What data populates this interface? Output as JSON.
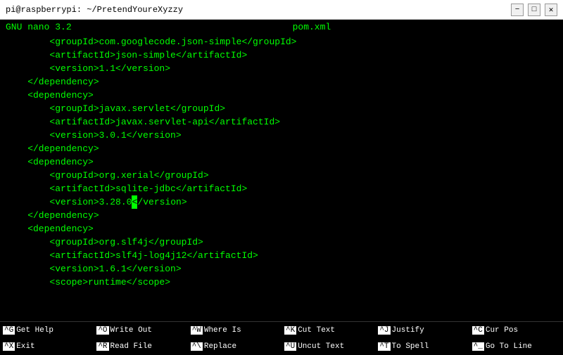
{
  "titlebar": {
    "text": "pi@raspberrypi: ~/PretendYoureXyzzy",
    "minimize": "−",
    "maximize": "□",
    "close": "✕"
  },
  "nano": {
    "header_left": "GNU nano 3.2",
    "filename": "pom.xml"
  },
  "editor": {
    "lines": [
      "        <groupId>com.googlecode.json-simple</groupId>",
      "        <artifactId>json-simple</artifactId>",
      "        <version>1.1</version>",
      "    </dependency>",
      "    <dependency>",
      "        <groupId>javax.servlet</groupId>",
      "        <artifactId>javax.servlet-api</artifactId>",
      "        <version>3.0.1</version>",
      "    </dependency>",
      "    <dependency>",
      "        <groupId>org.xerial</groupId>",
      "        <artifactId>sqlite-jdbc</artifactId>",
      "        <version>3.28.0</version>",
      "    </dependency>",
      "    <dependency>",
      "        <groupId>org.slf4j</groupId>",
      "        <artifactId>slf4j-log4j12</artifactId>",
      "        <version>1.6.1</version>",
      "        <scope>runtime</scope>"
    ],
    "cursor_line": 12,
    "cursor_col": 34
  },
  "shortcuts": [
    {
      "key": "^G",
      "label": "Get Help"
    },
    {
      "key": "^O",
      "label": "Write Out"
    },
    {
      "key": "^W",
      "label": "Where Is"
    },
    {
      "key": "^K",
      "label": "Cut Text"
    },
    {
      "key": "^J",
      "label": "Justify"
    },
    {
      "key": "^C",
      "label": "Cur Pos"
    },
    {
      "key": "^X",
      "label": "Exit"
    },
    {
      "key": "^R",
      "label": "Read File"
    },
    {
      "key": "^\\",
      "label": "Replace"
    },
    {
      "key": "^U",
      "label": "Uncut Text"
    },
    {
      "key": "^T",
      "label": "To Spell"
    },
    {
      "key": "^_",
      "label": "Go To Line"
    }
  ]
}
